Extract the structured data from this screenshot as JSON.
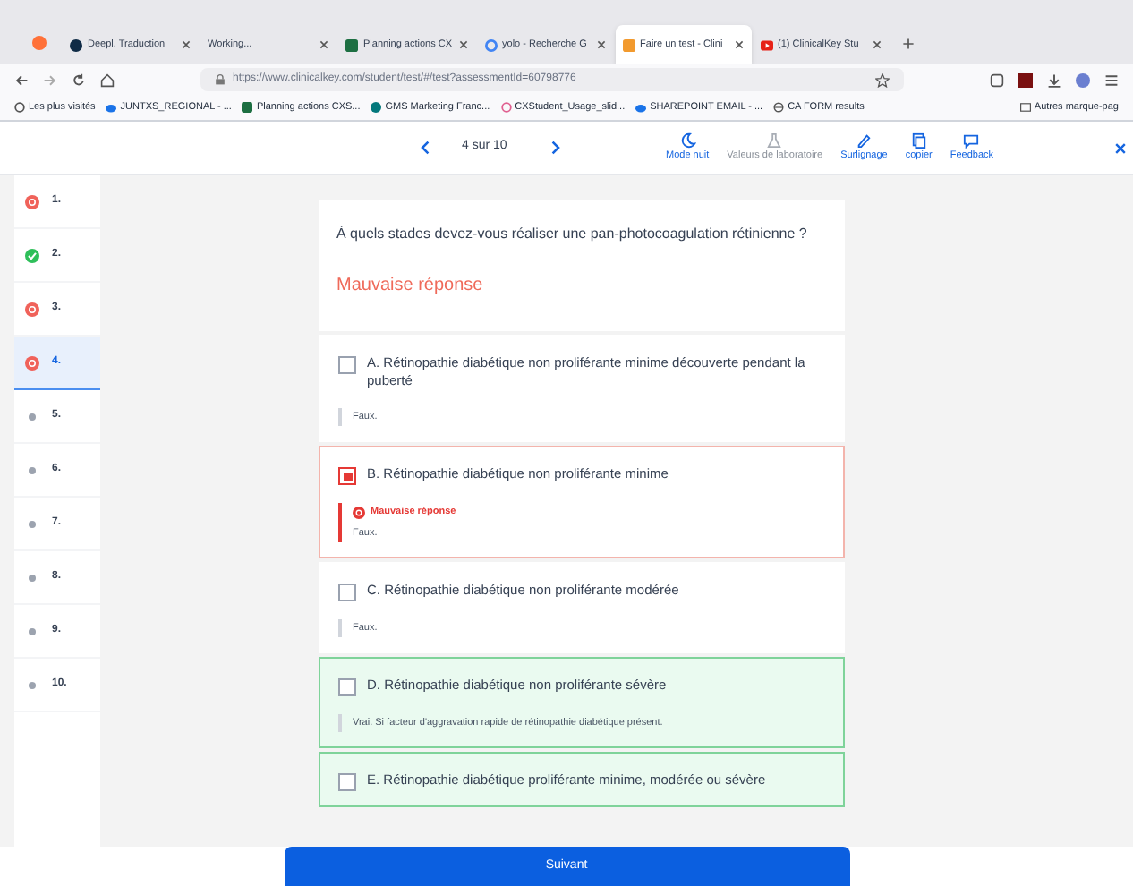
{
  "browser": {
    "tabs": [
      {
        "title": "Deepl. Traduction",
        "selected": false
      },
      {
        "title": "Working...",
        "selected": false
      },
      {
        "title": "Planning actions CX",
        "selected": false
      },
      {
        "title": "yolo - Recherche G",
        "selected": false
      },
      {
        "title": "Faire un test - Clini",
        "selected": true
      },
      {
        "title": "(1) ClinicalKey Stu",
        "selected": false
      }
    ],
    "url": "https://www.clinicalkey.com/student/test/#/test?assessmentId=60798776",
    "bookmarks": [
      "Les plus visités",
      "JUNTXS_REGIONAL - ...",
      "Planning actions CXS...",
      "GMS Marketing Franc...",
      "CXStudent_Usage_slid...",
      "SHAREPOINT EMAIL - ...",
      "CA FORM results"
    ],
    "other_bookmarks": "Autres marque-pag"
  },
  "toolbar": {
    "position": "4 sur 10",
    "tools": [
      {
        "label": "Mode nuit",
        "disabled": false
      },
      {
        "label": "Valeurs de laboratoire",
        "disabled": true
      },
      {
        "label": "Surlignage",
        "disabled": false
      },
      {
        "label": "copier",
        "disabled": false
      },
      {
        "label": "Feedback",
        "disabled": false
      }
    ]
  },
  "questions": [
    {
      "number": "1.",
      "kind": "wrong",
      "selected": false
    },
    {
      "number": "2.",
      "kind": "correct",
      "selected": false
    },
    {
      "number": "3.",
      "kind": "wrong",
      "selected": false
    },
    {
      "number": "4.",
      "kind": "wrong",
      "selected": true
    },
    {
      "number": "5.",
      "kind": "unanswered",
      "selected": false
    },
    {
      "number": "6.",
      "kind": "unanswered",
      "selected": false
    },
    {
      "number": "7.",
      "kind": "unanswered",
      "selected": false
    },
    {
      "number": "8.",
      "kind": "unanswered",
      "selected": false
    },
    {
      "number": "9.",
      "kind": "unanswered",
      "selected": false
    },
    {
      "number": "10.",
      "kind": "unanswered",
      "selected": false
    }
  ],
  "question": {
    "text": "À quels stades devez-vous réaliser une pan-photocoagulation rétinienne ?",
    "result": "Mauvaise réponse"
  },
  "options": [
    {
      "text": "A. Rétinopathie diabétique non proliférante minime découverte pendant la puberté",
      "checked": false,
      "kind": "neutral",
      "feedback": "Faux."
    },
    {
      "text": "B. Rétinopathie diabétique non proliférante minime",
      "checked": true,
      "kind": "wrong",
      "verdict": "Mauvaise réponse",
      "feedback": "Faux."
    },
    {
      "text": "C. Rétinopathie diabétique non proliférante modérée",
      "checked": false,
      "kind": "neutral",
      "feedback": "Faux."
    },
    {
      "text": "D. Rétinopathie diabétique non proliférante sévère",
      "checked": false,
      "kind": "correct",
      "feedback": "Vrai. Si facteur d'aggravation rapide de rétinopathie diabétique présent."
    },
    {
      "text": "E. Rétinopathie diabétique proliférante minime, modérée ou sévère",
      "checked": false,
      "kind": "correct"
    }
  ],
  "next_button": "Suivant"
}
